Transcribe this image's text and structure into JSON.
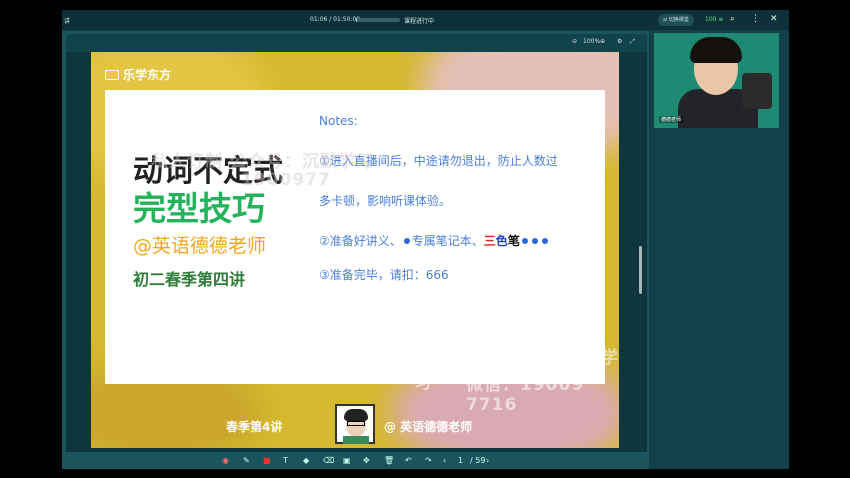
{
  "window": {
    "title": "讲",
    "time": "01:06 / 01:50:00",
    "status": "课程进行中",
    "progress_fraction": 0.02,
    "switch_label": "⇄ 切换课堂",
    "network": "100 ≡",
    "icons": [
      "zoom-icon",
      "more-icon",
      "close-icon"
    ]
  },
  "slidebar": {
    "zoom": "100%",
    "page_id": "V2.4.1"
  },
  "slide": {
    "logo": "乐学东方",
    "title_line1": "动词不定式",
    "title_line2": "完型技巧",
    "teacher": "@英语德德老师",
    "course": "初二春季第四讲",
    "notes_head": "Notes:",
    "note1": "①进入直播间后，中途请勿退出，防止人数过",
    "note1b": "多卡顿，影响听课体验。",
    "note2_pre": "②准备好讲义、",
    "note2_mid": "专属笔记本、",
    "note2_red": "三",
    "note2_blue": "色",
    "note2_end": "笔",
    "note3": "③准备完毕，请扣：666",
    "watermark1": "私人订制 公众号：沉默学习",
    "watermark1b": "1900977",
    "watermark2": "私人订制 公众号：沉默学习",
    "watermark3": "微信：19009 7716",
    "bottom_left": "春季第4讲",
    "bottom_right": "@ 英语德德老师"
  },
  "toolbar": {
    "tools": [
      "record-icon",
      "pen-icon",
      "color-icon",
      "text-icon",
      "shape-icon",
      "eraser-icon",
      "screenshot-icon",
      "move-icon",
      "delete-icon",
      "undo-icon",
      "redo-icon",
      "prev-icon"
    ],
    "page": "1",
    "total": "/ 59"
  },
  "camera": {
    "name": "德德老师"
  },
  "colors": {
    "app_bg": "#12414a",
    "green_title": "#24b25a",
    "orange_teacher": "#f5a51d",
    "notes_blue": "#4a7ee0"
  }
}
